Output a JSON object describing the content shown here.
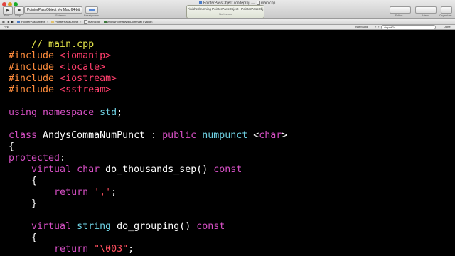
{
  "window": {
    "tab_title": "PointerPassObject.xcodeproj",
    "file_title": "main.cpp"
  },
  "toolbar": {
    "run_label": "Run",
    "stop_label": "Stop",
    "scheme": "PointerPassObject  My Mac 64-bit",
    "scheme_label": "Scheme",
    "breakpoints_label": "Breakpoints",
    "status_main": "Finished running PointerPassObject : PointerPassObj",
    "status_sub": "No Issues",
    "editor_label": "Editor",
    "view_label": "View",
    "organizer_label": "Organizer"
  },
  "jumpbar": {
    "items": [
      "PointerPassObject",
      "PointerPassObject",
      "main.cpp",
      "AndysFormatWithCommas(T value)"
    ]
  },
  "findbar": {
    "find_label": "Find",
    "result_label": "Not found",
    "search_value": "inputGo",
    "done_label": "Done"
  },
  "code": {
    "line_01": [
      "// main.cpp"
    ],
    "line_03": [
      "#include",
      " ",
      "<iomanip>"
    ],
    "line_04": [
      "#include",
      " ",
      "<locale>"
    ],
    "line_05": [
      "#include",
      " ",
      "<iostream>"
    ],
    "line_06": [
      "#include",
      " ",
      "<sstream>"
    ],
    "line_08": [
      "using",
      " ",
      "namespace",
      " ",
      "std",
      ";"
    ],
    "line_10": [
      "class",
      " AndysCommaNumPunct : ",
      "public",
      " ",
      "numpunct",
      " <",
      "char",
      ">"
    ],
    "line_11": [
      "{"
    ],
    "line_12": [
      "protected",
      ":"
    ],
    "line_13": [
      "    ",
      "virtual",
      " ",
      "char",
      " do_thousands_sep() ",
      "const"
    ],
    "line_14": [
      "    {"
    ],
    "line_15": [
      "        ",
      "return",
      " ",
      "','",
      ";"
    ],
    "line_16": [
      "    }"
    ],
    "line_18": [
      "    ",
      "virtual",
      " ",
      "string",
      " do_grouping() ",
      "const"
    ],
    "line_19": [
      "    {"
    ],
    "line_20": [
      "        ",
      "return",
      " ",
      "\"\\003\"",
      ";"
    ]
  },
  "colors": {
    "comment": "#e6e64a",
    "preprocessor": "#ff8c3c",
    "header": "#ff3e6c",
    "keyword": "#d64fc4",
    "type": "#6fd1e3",
    "string": "#ff4f5f",
    "background": "#000000"
  }
}
